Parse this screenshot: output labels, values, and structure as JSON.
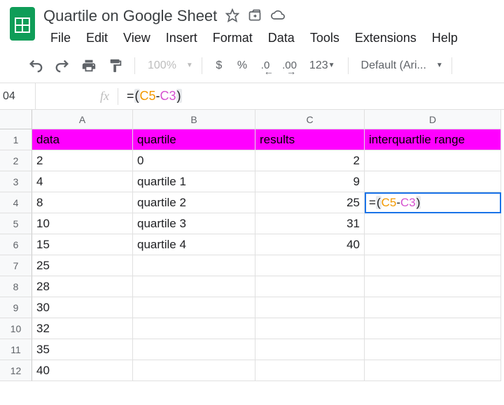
{
  "doc": {
    "title": "Quartile on Google Sheet"
  },
  "menu": {
    "file": "File",
    "edit": "Edit",
    "view": "View",
    "insert": "Insert",
    "format": "Format",
    "data": "Data",
    "tools": "Tools",
    "extensions": "Extensions",
    "help": "Help"
  },
  "toolbar": {
    "zoom": "100%",
    "currency": "$",
    "percent": "%",
    "decdec": ".0",
    "incdec": ".00",
    "numfmt": "123",
    "font": "Default (Ari..."
  },
  "namebox": "04",
  "fx_label": "fx",
  "formula": {
    "eq": "=",
    "lp": "(",
    "ref1": "C5",
    "op": "-",
    "ref2": "C3",
    "rp": ")"
  },
  "cols": {
    "A": "A",
    "B": "B",
    "C": "C",
    "D": "D"
  },
  "rows": [
    "1",
    "2",
    "3",
    "4",
    "5",
    "6",
    "7",
    "8",
    "9",
    "10",
    "11",
    "12"
  ],
  "headers": {
    "A": "data",
    "B": "quartile",
    "C": "results",
    "D": "interquartlie range"
  },
  "data": {
    "A": [
      "2",
      "4",
      "8",
      "10",
      "15",
      "25",
      "28",
      "30",
      "32",
      "35",
      "40"
    ],
    "B": [
      "0",
      "quartile 1",
      "quartile 2",
      "quartile 3",
      "quartile 4",
      "",
      "",
      "",
      "",
      "",
      ""
    ],
    "C": [
      "2",
      "9",
      "25",
      "31",
      "40",
      "",
      "",
      "",
      "",
      "",
      ""
    ],
    "D_active": {
      "eq": "=",
      "lp": "(",
      "ref1": "C5",
      "op": "-",
      "ref2": "C3",
      "rp": ")"
    }
  }
}
